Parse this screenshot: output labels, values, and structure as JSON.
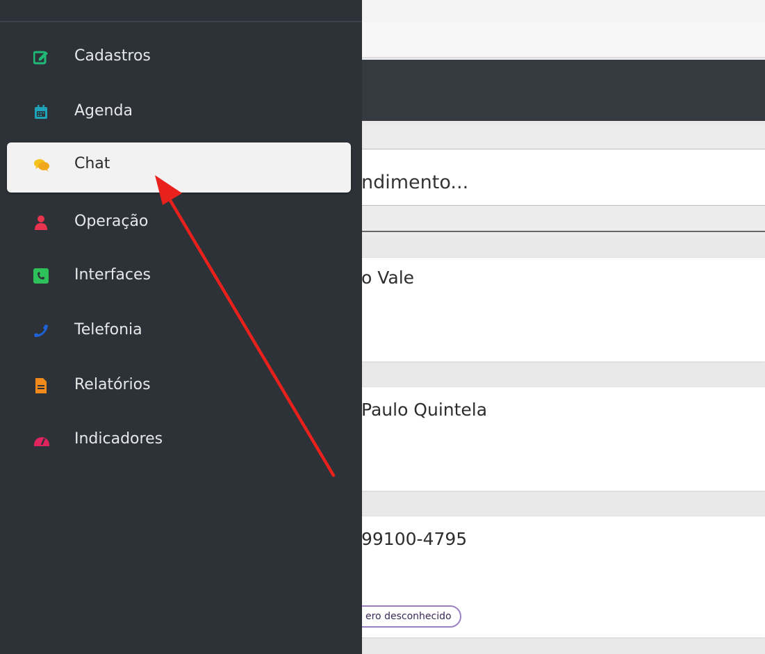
{
  "sidebar": {
    "items": [
      {
        "label": "Cadastros",
        "icon": "edit-icon",
        "color": "#1fb978",
        "active": false
      },
      {
        "label": "Agenda",
        "icon": "calendar-icon",
        "color": "#1fa3b8",
        "active": false
      },
      {
        "label": "Chat",
        "icon": "chat-icon",
        "color": "#f5c21b",
        "active": true
      },
      {
        "label": "Operação",
        "icon": "user-icon",
        "color": "#e8344f",
        "active": false
      },
      {
        "label": "Interfaces",
        "icon": "phone-square-icon",
        "color": "#2ec15a",
        "active": false
      },
      {
        "label": "Telefonia",
        "icon": "phone-icon",
        "color": "#1f63d6",
        "active": false
      },
      {
        "label": "Relatórios",
        "icon": "file-icon",
        "color": "#f28a1c",
        "active": false
      },
      {
        "label": "Indicadores",
        "icon": "dashboard-icon",
        "color": "#e0245e",
        "active": false
      }
    ]
  },
  "main": {
    "search_placeholder": "ndimento...",
    "cards": [
      {
        "text": "o Vale"
      },
      {
        "text": "Paulo Quintela"
      },
      {
        "text": "99100-4795",
        "tag": "ero desconhecido"
      }
    ]
  },
  "annotation": {
    "arrow_color": "#e8211c"
  }
}
